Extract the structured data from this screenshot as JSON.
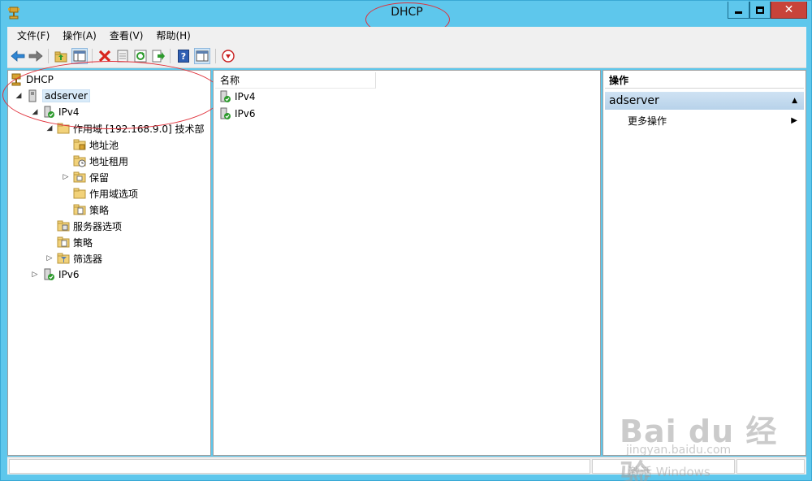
{
  "window": {
    "title": "DHCP",
    "controls": {
      "close_glyph": "✕"
    }
  },
  "menu": [
    "文件(F)",
    "操作(A)",
    "查看(V)",
    "帮助(H)"
  ],
  "toolbar": {
    "icons": [
      "back-icon",
      "forward-icon",
      "up-folder-icon",
      "show-hide-tree-icon",
      "delete-icon",
      "properties-icon",
      "refresh-icon",
      "export-list-icon",
      "help-icon",
      "action-pane-icon",
      "stop-icon"
    ]
  },
  "tree": {
    "root": "DHCP",
    "server": "adserver",
    "ipv4": "IPv4",
    "scope": "作用域 [192.168.9.0] 技术部",
    "scope_children": [
      "地址池",
      "地址租用",
      "保留",
      "作用域选项",
      "策略"
    ],
    "server_options": "服务器选项",
    "policies": "策略",
    "filters": "筛选器",
    "ipv6": "IPv6"
  },
  "list": {
    "column_name": "名称",
    "rows": [
      "IPv4",
      "IPv6"
    ]
  },
  "actions": {
    "header": "操作",
    "group": "adserver",
    "more": "更多操作"
  },
  "watermark": {
    "logo": "Bai du 经验",
    "url": "jingyan.baidu.com",
    "activate": "激活 Windows"
  },
  "colors": {
    "title_bar": "#5ec7ec",
    "annotation_circle": "#e0303a",
    "close_button": "#c8433a",
    "action_group": "#cfe2f3"
  }
}
